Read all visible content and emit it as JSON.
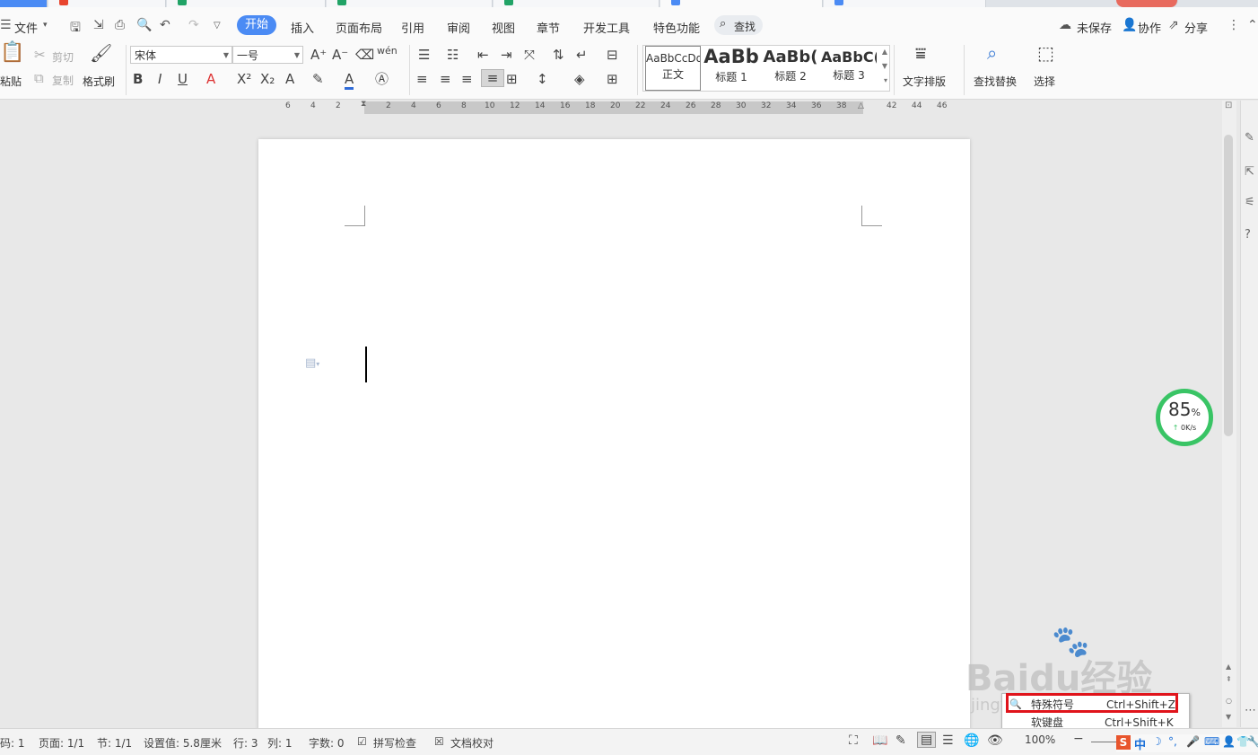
{
  "menu": {
    "file": "文件",
    "tabs": [
      "开始",
      "插入",
      "页面布局",
      "引用",
      "审阅",
      "视图",
      "章节",
      "开发工具",
      "特色功能"
    ],
    "search": "查找",
    "unsaved": "未保存",
    "collaborate": "协作",
    "share": "分享"
  },
  "ribbon": {
    "paste": "粘贴",
    "cut": "剪切",
    "copy": "复制",
    "format_painter": "格式刷",
    "font_name": "宋体",
    "font_size": "一号",
    "styles": [
      {
        "preview": "AaBbCcDd",
        "name": "正文"
      },
      {
        "preview": "AaBb",
        "name": "标题 1"
      },
      {
        "preview": "AaBb(",
        "name": "标题 2"
      },
      {
        "preview": "AaBbC(",
        "name": "标题 3"
      }
    ],
    "text_layout": "文字排版",
    "find_replace": "查找替换",
    "select": "选择"
  },
  "ruler_ticks": [
    "6",
    "4",
    "2",
    "2",
    "4",
    "6",
    "8",
    "10",
    "12",
    "14",
    "16",
    "18",
    "20",
    "22",
    "24",
    "26",
    "28",
    "30",
    "32",
    "34",
    "36",
    "38",
    "42",
    "44",
    "46"
  ],
  "speed_widget": {
    "percent": "85",
    "unit": "%",
    "rate": "0K/s"
  },
  "popup": {
    "items": [
      {
        "label": "特殊符号",
        "shortcut": "Ctrl+Shift+Z"
      },
      {
        "label": "软键盘",
        "shortcut": "Ctrl+Shift+K"
      }
    ]
  },
  "status": {
    "page_number": "码: 1",
    "page": "页面: 1/1",
    "section": "节: 1/1",
    "setting": "设置值: 5.8厘米",
    "row": "行: 3",
    "col": "列: 1",
    "word_count": "字数: 0",
    "spell_check": "拼写检查",
    "doc_proof": "文档校对",
    "zoom": "100%"
  },
  "ime": {
    "mode": "中"
  },
  "watermark": {
    "brand": "Baidu经验",
    "url": "jingyan.baidu.com"
  },
  "colors": {
    "accent": "#4b8bf4",
    "highlight_box": "#e0141b",
    "speed_ring": "#39c465"
  }
}
